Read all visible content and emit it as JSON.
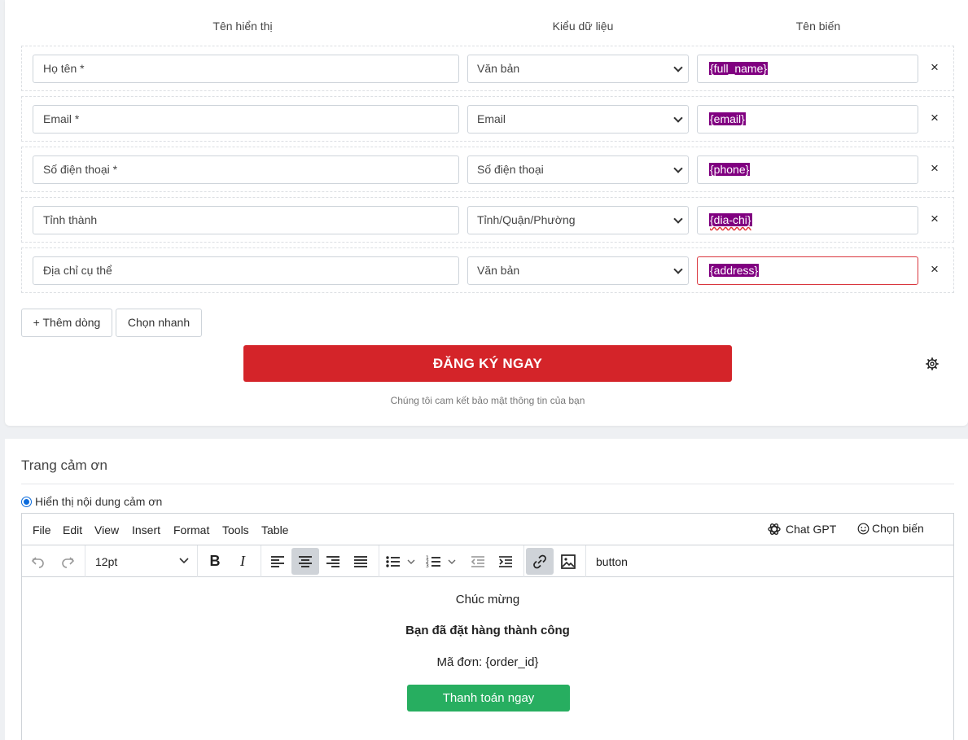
{
  "form": {
    "headers": {
      "name": "Tên hiển thị",
      "type": "Kiểu dữ liệu",
      "var": "Tên biến"
    },
    "rows": [
      {
        "name": "Họ tên *",
        "type": "Văn bản",
        "var": "{full_name}"
      },
      {
        "name": "Email *",
        "type": "Email",
        "var": "{email}"
      },
      {
        "name": "Số điện thoại *",
        "type": "Số điện thoại",
        "var": "{phone}"
      },
      {
        "name": "Tỉnh thành",
        "type": "Tỉnh/Quận/Phường",
        "var": "{dia-chi}"
      },
      {
        "name": "Địa chỉ cụ thể",
        "type": "Văn bản",
        "var": "{address}"
      }
    ],
    "remove_symbol": "×",
    "add_row_label": "+ Thêm dòng",
    "quick_pick_label": "Chọn nhanh",
    "submit_label": "ĐĂNG KÝ NGAY",
    "privacy_note": "Chúng tôi cam kết bảo mật thông tin của bạn",
    "var_highlight_color": "#800080",
    "submit_color": "#d42429"
  },
  "thankyou": {
    "section_title": "Trang cảm ơn",
    "show_content_label": "Hiển thị nội dung cảm ơn",
    "menu": [
      "File",
      "Edit",
      "View",
      "Insert",
      "Format",
      "Tools",
      "Table"
    ],
    "chatgpt_label": "Chat GPT",
    "choose_var_label": "Chọn biến",
    "font_size": "12pt",
    "button_label": "button",
    "content": {
      "line1": "Chúc mừng",
      "line2": "Bạn đã đặt hàng thành công",
      "line3": "Mã đơn:  {order_id}",
      "pay_button": "Thanh toán ngay"
    },
    "pay_button_color": "#27ae60"
  }
}
